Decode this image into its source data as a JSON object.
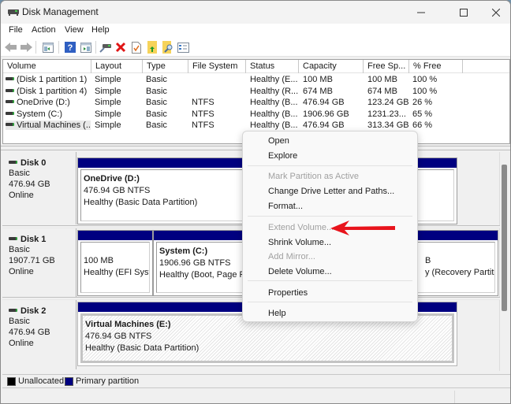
{
  "window": {
    "title": "Disk Management",
    "controls": [
      "minimize",
      "maximize",
      "close"
    ]
  },
  "menubar": [
    "File",
    "Action",
    "View",
    "Help"
  ],
  "toolbar": [
    {
      "icon": "back-arrow-icon",
      "enabled": false
    },
    {
      "icon": "forward-arrow-icon",
      "enabled": false
    },
    {
      "icon": "show-hide-console-tree-icon"
    },
    {
      "icon": "help-icon"
    },
    {
      "icon": "show-hide-action-pane-icon"
    },
    {
      "icon": "connect-drive-icon"
    },
    {
      "icon": "delete-icon"
    },
    {
      "icon": "properties-check-icon"
    },
    {
      "icon": "folder-up-icon"
    },
    {
      "icon": "folder-search-icon"
    },
    {
      "icon": "settings-list-icon"
    }
  ],
  "volume_list": {
    "columns": [
      "Volume",
      "Layout",
      "Type",
      "File System",
      "Status",
      "Capacity",
      "Free Sp...",
      "% Free"
    ],
    "rows": [
      {
        "volume": "(Disk 1 partition 1)",
        "layout": "Simple",
        "type": "Basic",
        "fs": "",
        "status": "Healthy (E...",
        "capacity": "100 MB",
        "free": "100 MB",
        "pct": "100 %"
      },
      {
        "volume": "(Disk 1 partition 4)",
        "layout": "Simple",
        "type": "Basic",
        "fs": "",
        "status": "Healthy (R...",
        "capacity": "674 MB",
        "free": "674 MB",
        "pct": "100 %"
      },
      {
        "volume": "OneDrive (D:)",
        "layout": "Simple",
        "type": "Basic",
        "fs": "NTFS",
        "status": "Healthy (B...",
        "capacity": "476.94 GB",
        "free": "123.24 GB",
        "pct": "26 %"
      },
      {
        "volume": "System (C:)",
        "layout": "Simple",
        "type": "Basic",
        "fs": "NTFS",
        "status": "Healthy (B...",
        "capacity": "1906.96 GB",
        "free": "1231.23...",
        "pct": "65 %"
      },
      {
        "volume": "Virtual Machines (...",
        "layout": "Simple",
        "type": "Basic",
        "fs": "NTFS",
        "status": "Healthy (B...",
        "capacity": "476.94 GB",
        "free": "313.34 GB",
        "pct": "66 %"
      }
    ]
  },
  "disks": [
    {
      "name": "Disk 0",
      "type": "Basic",
      "size": "476.94 GB",
      "state": "Online",
      "partitions": [
        {
          "title": "OneDrive  (D:)",
          "size": "476.94 GB NTFS",
          "status": "Healthy (Basic Data Partition)"
        }
      ]
    },
    {
      "name": "Disk 1",
      "type": "Basic",
      "size": "1907.71 GB",
      "state": "Online",
      "partitions": [
        {
          "title": "",
          "size": "100 MB",
          "status": "Healthy (EFI Syste"
        },
        {
          "title": "System  (C:)",
          "size": "1906.96 GB NTFS",
          "status": "Healthy (Boot, Page File"
        },
        {
          "title": "",
          "size": "B",
          "status": "y (Recovery Partitior"
        }
      ]
    },
    {
      "name": "Disk 2",
      "type": "Basic",
      "size": "476.94 GB",
      "state": "Online",
      "partitions": [
        {
          "title": "Virtual Machines  (E:)",
          "size": "476.94 GB NTFS",
          "status": "Healthy (Basic Data Partition)",
          "selected": true
        }
      ]
    }
  ],
  "legend": [
    {
      "label": "Unallocated",
      "color": "#000000"
    },
    {
      "label": "Primary partition",
      "color": "#000080"
    }
  ],
  "context_menu": {
    "items": [
      {
        "label": "Open",
        "enabled": true
      },
      {
        "label": "Explore",
        "enabled": true
      },
      {
        "separator": true
      },
      {
        "label": "Mark Partition as Active",
        "enabled": false
      },
      {
        "label": "Change Drive Letter and Paths...",
        "enabled": true
      },
      {
        "label": "Format...",
        "enabled": true
      },
      {
        "separator": true
      },
      {
        "label": "Extend Volume...",
        "enabled": false,
        "highlighted_by_arrow": true
      },
      {
        "label": "Shrink Volume...",
        "enabled": true
      },
      {
        "label": "Add Mirror...",
        "enabled": false
      },
      {
        "label": "Delete Volume...",
        "enabled": true
      },
      {
        "separator": true
      },
      {
        "label": "Properties",
        "enabled": true
      },
      {
        "separator": true
      },
      {
        "label": "Help",
        "enabled": true
      }
    ]
  },
  "colors": {
    "primary_partition": "#000080",
    "annotation_arrow": "#e8141c"
  }
}
